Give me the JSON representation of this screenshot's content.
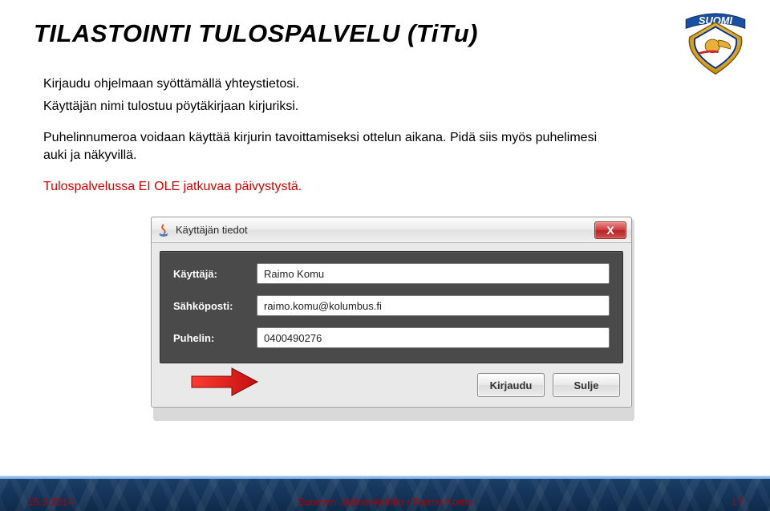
{
  "title": "TILASTOINTI TULOSPALVELU  (TiTu)",
  "paragraphs": {
    "p1": "Kirjaudu ohjelmaan syöttämällä yhteystietosi.",
    "p2": "Käyttäjän nimi tulostuu pöytäkirjaan kirjuriksi.",
    "p3": "Puhelinnumeroa voidaan käyttää kirjurin tavoittamiseksi ottelun aikana. Pidä siis myös puhelimesi auki ja näkyvillä.",
    "p4": "Tulospalvelussa EI OLE jatkuvaa päivystystä."
  },
  "dialog": {
    "title": "Käyttäjän tiedot",
    "close": "X",
    "rows": {
      "user_label": "Käyttäjä:",
      "user_value": "Raimo Komu",
      "email_label": "Sähköposti:",
      "email_value": "raimo.komu@kolumbus.fi",
      "phone_label": "Puhelin:",
      "phone_value": "0400490276"
    },
    "buttons": {
      "login": "Kirjaudu",
      "close_btn": "Sulje"
    }
  },
  "footer": {
    "date": "15.9.2014",
    "center": "Suomen Jääkiekkoliitto / Raimo Komu",
    "page": "17"
  },
  "logo": {
    "banner_text": "SUOMI"
  }
}
